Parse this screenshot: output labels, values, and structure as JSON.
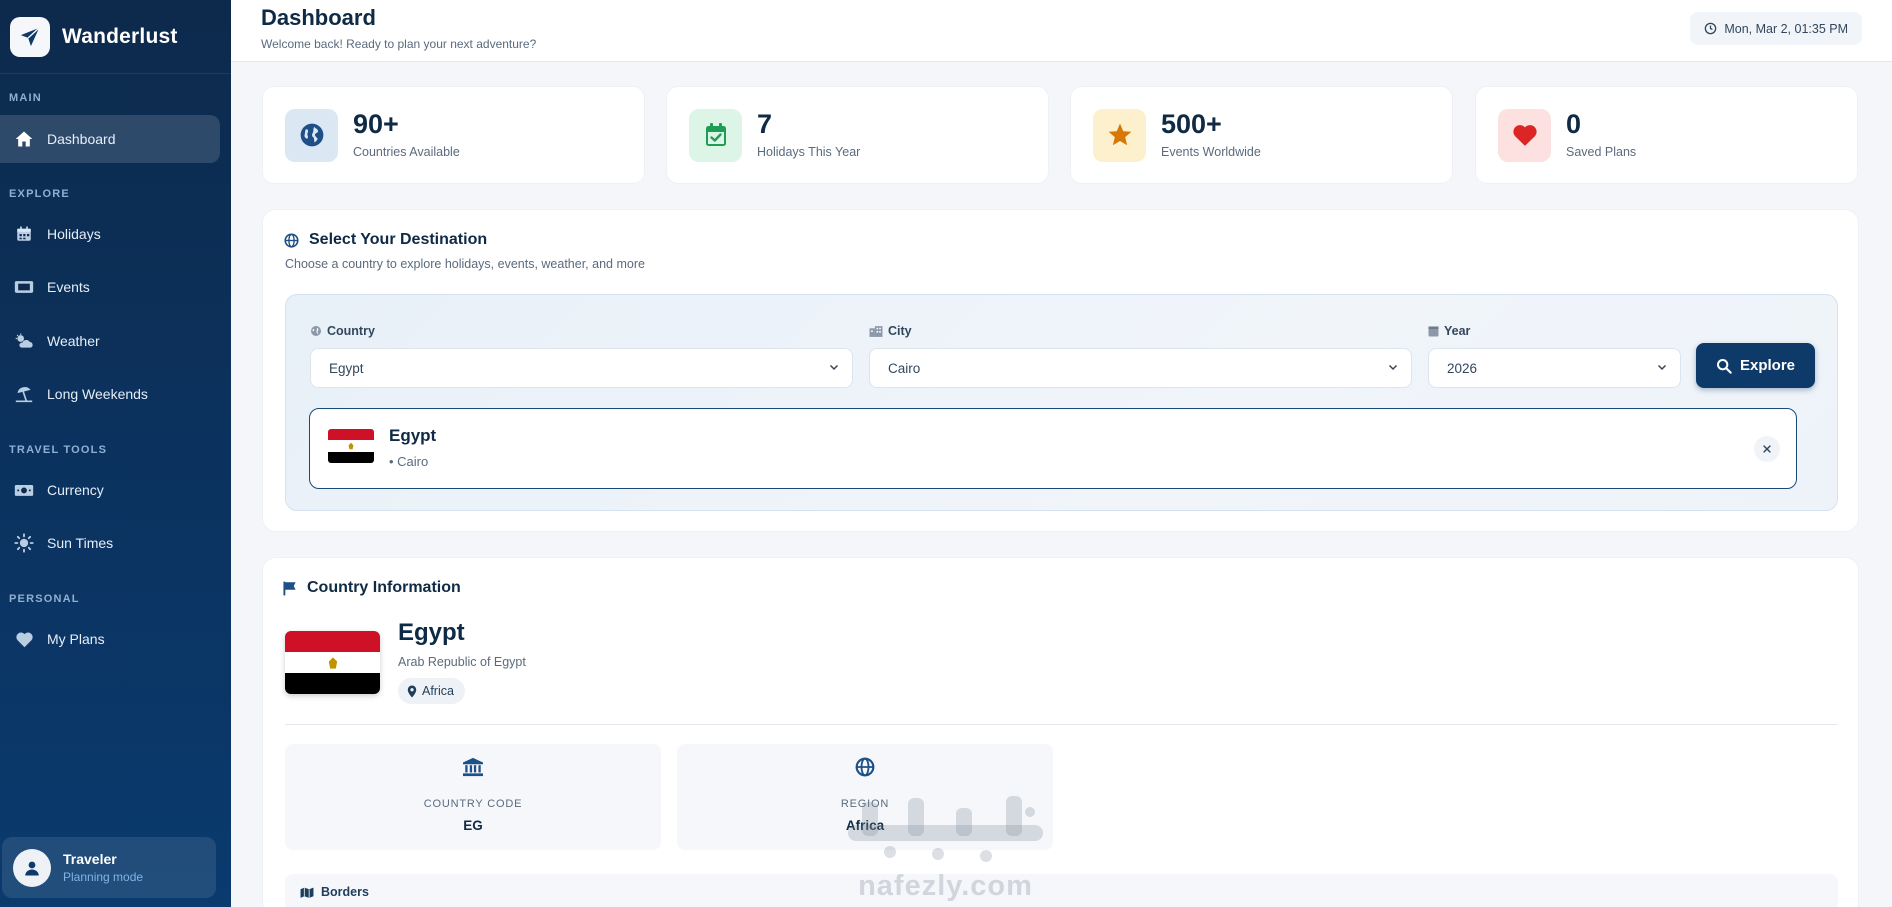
{
  "app": {
    "name": "Wanderlust"
  },
  "sidebar": {
    "sections": [
      {
        "label": "MAIN"
      },
      {
        "label": "EXPLORE"
      },
      {
        "label": "TRAVEL TOOLS"
      },
      {
        "label": "PERSONAL"
      }
    ],
    "items": [
      {
        "label": "Dashboard",
        "icon": "home-icon",
        "active": true
      },
      {
        "label": "Holidays",
        "icon": "calendar-icon"
      },
      {
        "label": "Events",
        "icon": "ticket-icon"
      },
      {
        "label": "Weather",
        "icon": "cloud-sun-icon"
      },
      {
        "label": "Long Weekends",
        "icon": "umbrella-beach-icon"
      },
      {
        "label": "Currency",
        "icon": "money-icon"
      },
      {
        "label": "Sun Times",
        "icon": "sun-icon"
      },
      {
        "label": "My Plans",
        "icon": "heart-icon"
      }
    ],
    "user": {
      "name": "Traveler",
      "status": "Planning mode"
    }
  },
  "header": {
    "title": "Dashboard",
    "subtitle": "Welcome back! Ready to plan your next adventure?",
    "datetime": "Mon, Mar 2, 01:35 PM"
  },
  "stats": [
    {
      "value": "90+",
      "label": "Countries Available",
      "icon": "globe-icon",
      "color": "#1e4f86",
      "bg": "#dbe7f3"
    },
    {
      "value": "7",
      "label": "Holidays This Year",
      "icon": "calendar-check-icon",
      "color": "#1f9d55",
      "bg": "#ddf5e6"
    },
    {
      "value": "500+",
      "label": "Events Worldwide",
      "icon": "star-icon",
      "color": "#d97706",
      "bg": "#fdf0cc"
    },
    {
      "value": "0",
      "label": "Saved Plans",
      "icon": "heart-icon",
      "color": "#dc2626",
      "bg": "#fde1e1"
    }
  ],
  "destination": {
    "title": "Select Your Destination",
    "subtitle": "Choose a country to explore holidays, events, weather, and more",
    "country_label": "Country",
    "country_value": "Egypt",
    "city_label": "City",
    "city_value": "Cairo",
    "year_label": "Year",
    "year_value": "2026",
    "explore_label": "Explore",
    "selected": {
      "country": "Egypt",
      "city": "• Cairo",
      "clear": "×"
    }
  },
  "country_info": {
    "title": "Country Information",
    "name": "Egypt",
    "official_name": "Arab Republic of Egypt",
    "region": "Africa",
    "tiles": [
      {
        "label": "COUNTRY CODE",
        "value": "EG",
        "icon": "landmark-icon"
      },
      {
        "label": "REGION",
        "value": "Africa",
        "icon": "globe-icon"
      }
    ],
    "borders_label": "Borders"
  },
  "watermark": {
    "text": "nafezly.com"
  },
  "colors": {
    "sidebar": "#0b3360",
    "accent": "#0e3a6a",
    "background": "#f4f6f9"
  }
}
